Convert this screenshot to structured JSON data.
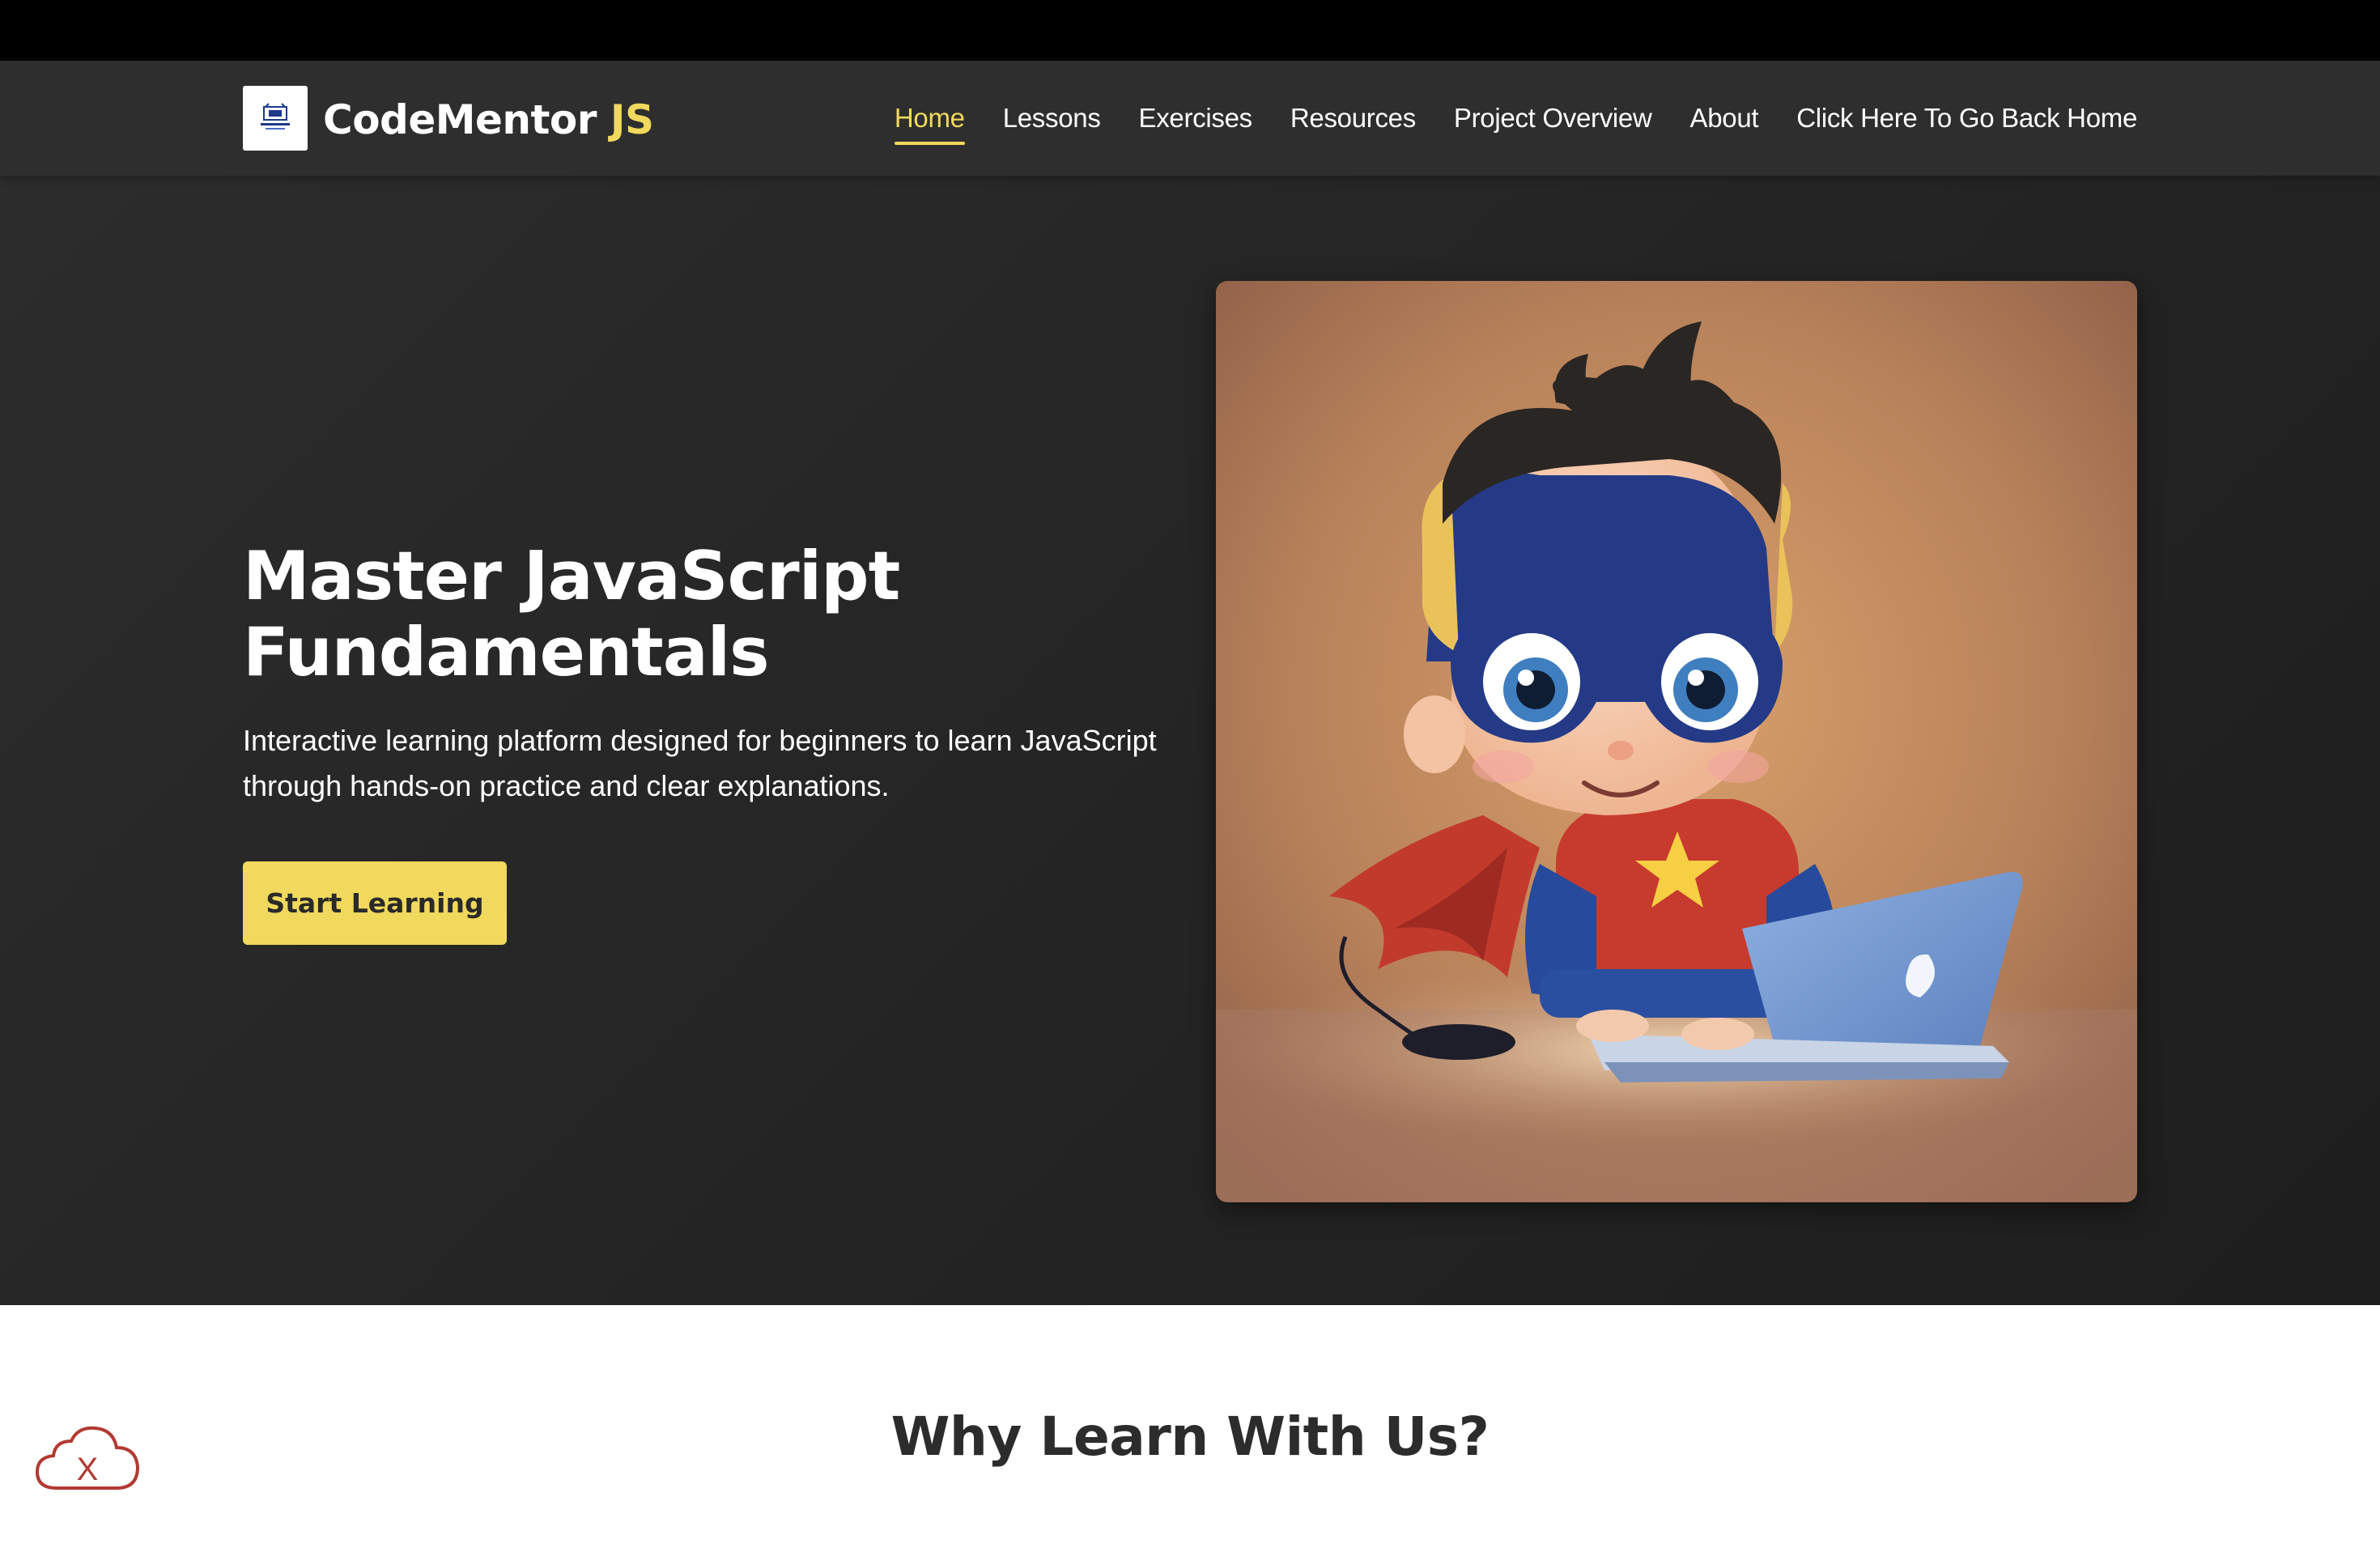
{
  "brand": {
    "name": "CodeMentor",
    "accent": "JS",
    "logo_icon": "code-mentor-logo-icon"
  },
  "nav": {
    "items": [
      {
        "label": "Home",
        "active": true
      },
      {
        "label": "Lessons"
      },
      {
        "label": "Exercises"
      },
      {
        "label": "Resources"
      },
      {
        "label": "Project Overview"
      },
      {
        "label": "About"
      },
      {
        "label": "Click Here To Go Back Home"
      }
    ]
  },
  "hero": {
    "title": "Master JavaScript Fundamentals",
    "description": "Interactive learning platform designed for beginners to learn JavaScript through hands-on practice and clear explanations.",
    "cta_label": "Start Learning",
    "image": "superhero-kid-with-laptop-illustration"
  },
  "features": {
    "title": "Why Learn With Us?"
  },
  "widget": {
    "icon": "cloud-offline-icon",
    "text": "X"
  },
  "colors": {
    "accent": "#f0d95c",
    "nav_bg": "#2e2e2e",
    "hero_bg": "#262626",
    "top_bar": "#000000",
    "cloud_icon": "#b23a32"
  }
}
